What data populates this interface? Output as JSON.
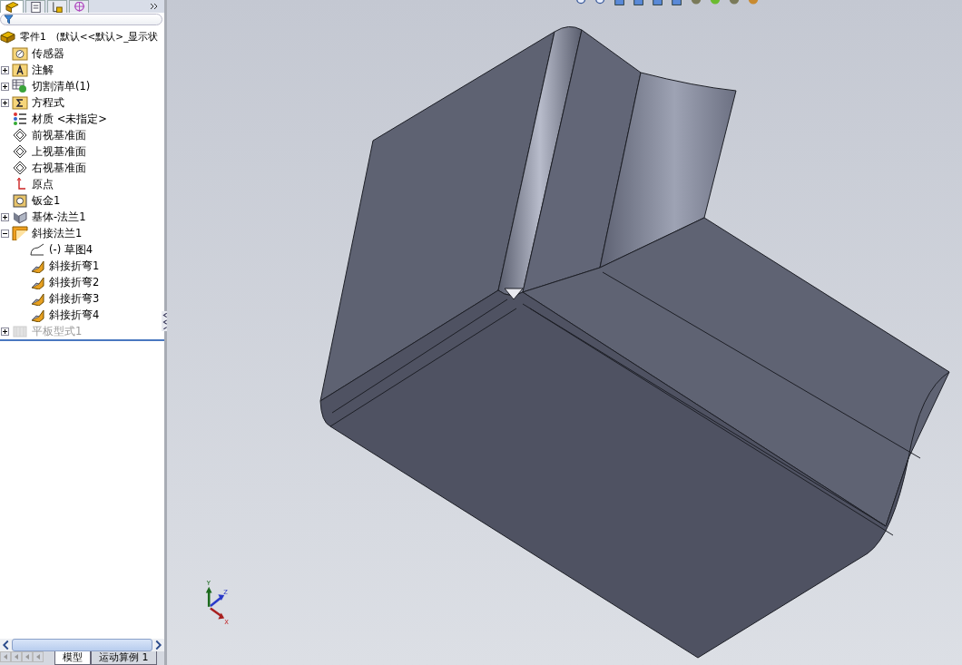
{
  "manager_tabs": [
    {
      "kind": "feature",
      "selected": true
    },
    {
      "kind": "property",
      "selected": false
    },
    {
      "kind": "config",
      "selected": false
    },
    {
      "kind": "dimxpert",
      "selected": false
    }
  ],
  "tree": {
    "label": "零件1　(默认<<默认>_显示状",
    "kind": "part",
    "children": [
      {
        "label": "传感器",
        "kind": "sensor",
        "disabled": false
      },
      {
        "label": "注解",
        "kind": "annotation",
        "expanded": false,
        "disabled": false
      },
      {
        "label": "切割清单(1)",
        "kind": "cutlist",
        "expanded": false,
        "disabled": false
      },
      {
        "label": "方程式",
        "kind": "equation",
        "expanded": false,
        "disabled": false
      },
      {
        "label": "材质 <未指定>",
        "kind": "material",
        "disabled": false
      },
      {
        "label": "前视基准面",
        "kind": "plane",
        "disabled": false
      },
      {
        "label": "上视基准面",
        "kind": "plane",
        "disabled": false
      },
      {
        "label": "右视基准面",
        "kind": "plane",
        "disabled": false
      },
      {
        "label": "原点",
        "kind": "origin",
        "disabled": false
      },
      {
        "label": "钣金1",
        "kind": "sheetmetal",
        "disabled": false
      },
      {
        "label": "基体-法兰1",
        "kind": "baseflange",
        "expanded": false,
        "disabled": false
      },
      {
        "label": "斜接法兰1",
        "kind": "miterflange",
        "expanded": true,
        "disabled": false,
        "children": [
          {
            "label": "(-) 草图4",
            "kind": "sketch",
            "disabled": false
          },
          {
            "label": "斜接折弯1",
            "kind": "miterbend",
            "disabled": false
          },
          {
            "label": "斜接折弯2",
            "kind": "miterbend",
            "disabled": false
          },
          {
            "label": "斜接折弯3",
            "kind": "miterbend",
            "disabled": false
          },
          {
            "label": "斜接折弯4",
            "kind": "miterbend",
            "disabled": false
          }
        ]
      },
      {
        "label": "平板型式1",
        "kind": "flatpattern",
        "expanded": false,
        "disabled": true
      }
    ]
  },
  "bottom_tabs": [
    {
      "label": "模型",
      "selected": true
    },
    {
      "label": "运动算例 1",
      "selected": false
    }
  ],
  "triad": {
    "x": "X",
    "y": "Y",
    "z": "Z"
  }
}
